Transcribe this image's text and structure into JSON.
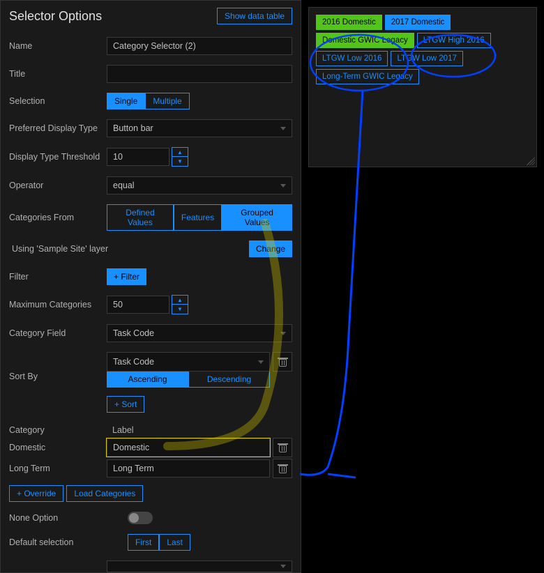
{
  "header": {
    "title": "Selector Options",
    "show_data_table": "Show data table"
  },
  "fields": {
    "name_label": "Name",
    "name_value": "Category Selector (2)",
    "title_label": "Title",
    "title_value": "",
    "selection_label": "Selection",
    "selection_single": "Single",
    "selection_multiple": "Multiple",
    "pref_display_label": "Preferred Display Type",
    "pref_display_value": "Button bar",
    "threshold_label": "Display Type Threshold",
    "threshold_value": "10",
    "operator_label": "Operator",
    "operator_value": "equal",
    "categories_from_label": "Categories From",
    "cat_defined": "Defined Values",
    "cat_features": "Features",
    "cat_grouped": "Grouped Values",
    "using_layer": " Using 'Sample Site' layer",
    "change_btn": "Change",
    "filter_label": "Filter",
    "filter_btn": "+ Filter",
    "max_cat_label": "Maximum Categories",
    "max_cat_value": "50",
    "cat_field_label": "Category Field",
    "cat_field_value": "Task Code",
    "sort_by_label": "Sort By",
    "sort_field_value": "Task Code",
    "sort_asc": "Ascending",
    "sort_desc": "Descending",
    "sort_add": "+ Sort",
    "cat_header": "Category",
    "label_header": "Label",
    "rows": [
      {
        "cat": "Domestic",
        "label": "Domestic"
      },
      {
        "cat": "Long Term",
        "label": "Long Term"
      }
    ],
    "override_btn": "+ Override",
    "load_cat_btn": "Load Categories",
    "none_option_label": "None Option",
    "default_sel_label": "Default selection",
    "default_first": "First",
    "default_last": "Last"
  },
  "preview": {
    "buttons": [
      {
        "label": "2016 Domestic",
        "style": "sel1"
      },
      {
        "label": "2017 Domestic",
        "style": "sel2"
      },
      {
        "label": "Domestic GWIC Legacy",
        "style": "sel3"
      },
      {
        "label": "LTGW High 2016",
        "style": ""
      },
      {
        "label": "LTGW Low 2016",
        "style": ""
      },
      {
        "label": "LTGW Low 2017",
        "style": ""
      },
      {
        "label": "Long-Term GWIC Legacy",
        "style": ""
      }
    ]
  }
}
